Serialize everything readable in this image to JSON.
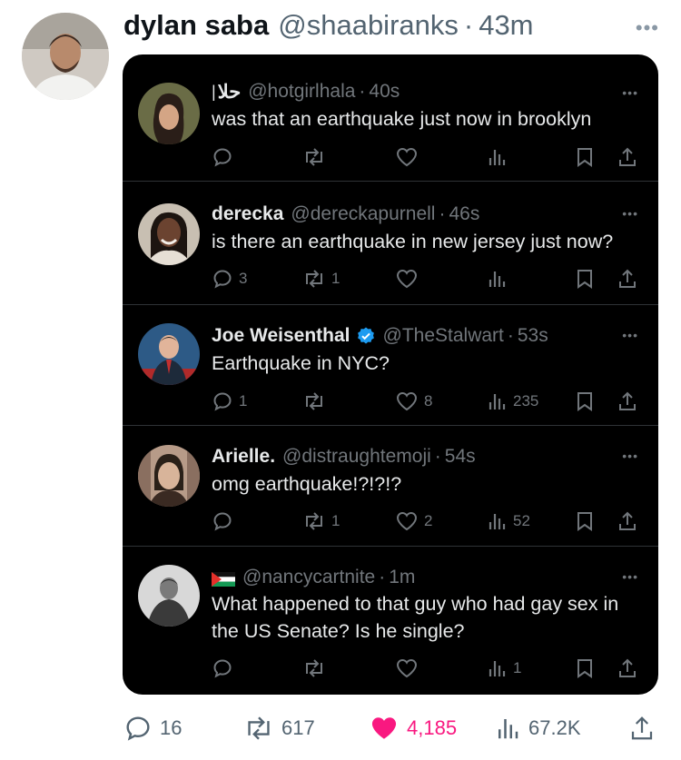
{
  "tweet": {
    "author_name": "dylan saba",
    "author_handle": "@shaabiranks",
    "time": "43m",
    "avatar_icon": "user-avatar-photo",
    "stats": {
      "replies": "16",
      "reposts": "617",
      "likes": "4,185",
      "views": "67.2K"
    },
    "like_color": "#f91880"
  },
  "embedded": {
    "background": "#000000",
    "replies": [
      {
        "name": "حلا",
        "handle": "@hotgirlhala",
        "time": "40s",
        "text": "was that an earthquake just now in brooklyn",
        "replies": "",
        "reposts": "",
        "likes": "",
        "views": ""
      },
      {
        "name": "derecka",
        "handle": "@dereckapurnell",
        "time": "46s",
        "text": "is there an earthquake in new jersey just now?",
        "replies": "3",
        "reposts": "1",
        "likes": "",
        "views": ""
      },
      {
        "name": "Joe Weisenthal",
        "handle": "@TheStalwart",
        "time": "53s",
        "text": "Earthquake in NYC?",
        "verified": true,
        "replies": "1",
        "reposts": "",
        "likes": "8",
        "views": "235"
      },
      {
        "name": "Arielle.",
        "handle": "@distraughtemoji",
        "time": "54s",
        "text": "omg earthquake!?!?!?",
        "replies": "",
        "reposts": "1",
        "likes": "2",
        "views": "52"
      },
      {
        "name": "",
        "handle": "@nancycartnite",
        "time": "1m",
        "text": "What happened to that guy who had gay sex in the US Senate? Is he single?",
        "flag_icon": "palestine-flag-icon",
        "replies": "",
        "reposts": "",
        "likes": "",
        "views": "1"
      }
    ]
  }
}
